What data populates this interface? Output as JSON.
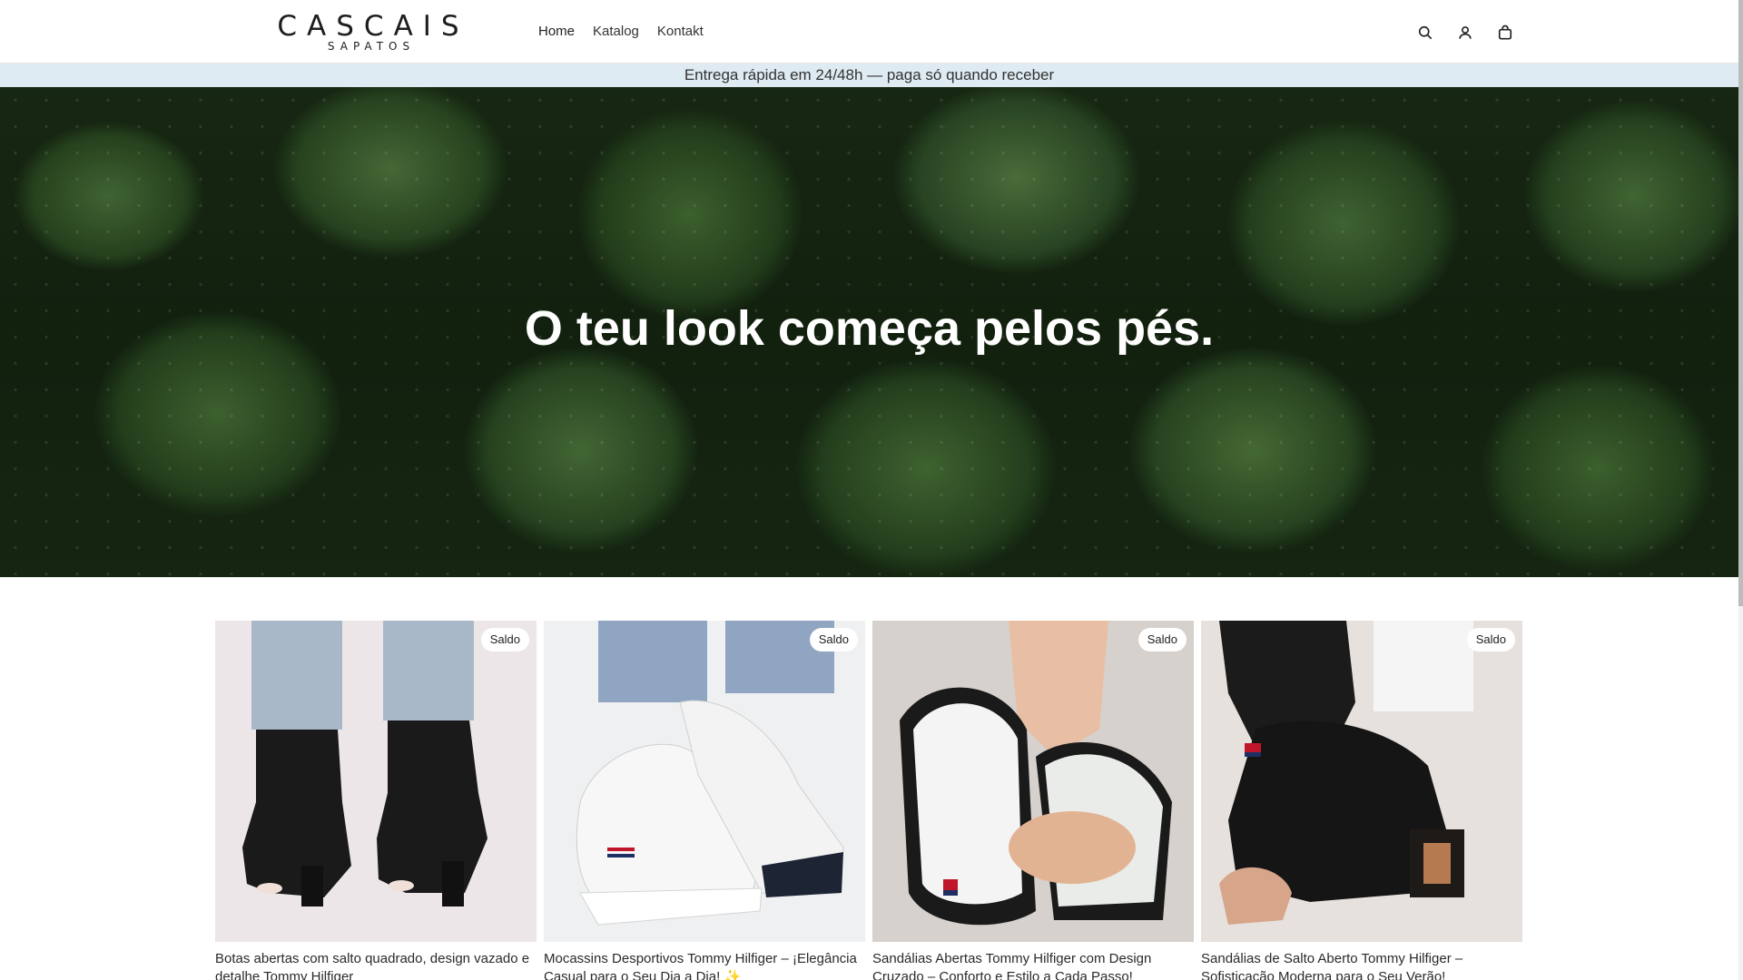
{
  "header": {
    "logo_main": "CASCAIS",
    "logo_sub": "SAPATOS",
    "nav": [
      {
        "label": "Home"
      },
      {
        "label": "Katalog"
      },
      {
        "label": "Kontakt"
      }
    ],
    "icons": [
      "search-icon",
      "account-icon",
      "cart-icon"
    ]
  },
  "announcement": {
    "text": "Entrega rápida em 24/48h — paga só quando receber"
  },
  "hero": {
    "title": "O teu look começa pelos pés."
  },
  "products": [
    {
      "badge": "Saldo",
      "title": "Botas abertas com salto quadrado, design vazado e detalhe Tommy Hilfiger"
    },
    {
      "badge": "Saldo",
      "title": "Mocassins Desportivos Tommy Hilfiger – ¡Elegância Casual para o Seu Dia a Dia! ✨"
    },
    {
      "badge": "Saldo",
      "title": "Sandálias Abertas Tommy Hilfiger com Design Cruzado – Conforto e Estilo a Cada Passo!"
    },
    {
      "badge": "Saldo",
      "title": "Sandálias de Salto Aberto Tommy Hilfiger – Sofisticação Moderna para o Seu Verão!"
    }
  ],
  "colors": {
    "announcement_bg": "#deebf2",
    "hero_foliage": "#2e4f24",
    "badge_bg": "#ffffff"
  }
}
